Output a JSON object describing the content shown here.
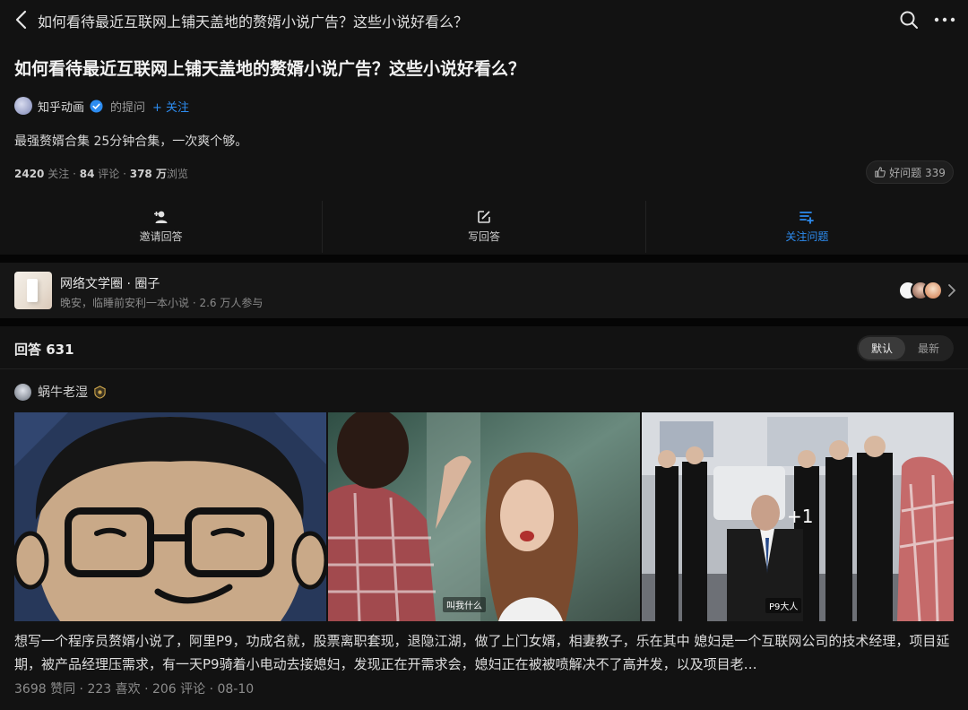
{
  "header": {
    "title": "如何看待最近互联网上铺天盖地的赘婿小说广告？这些小说好看么？"
  },
  "question": {
    "title": "如何看待最近互联网上铺天盖地的赘婿小说广告？这些小说好看么？",
    "asker_name": "知乎动画",
    "asker_role": "的提问",
    "follow_label": "+ 关注",
    "description": "最强赘婿合集 25分钟合集，一次爽个够。",
    "followers_count": "2420",
    "followers_label": "关注",
    "comments_count": "84",
    "comments_label": "评论",
    "views_count": "378 万",
    "views_label": "浏览",
    "good_question_label": "好问题 339"
  },
  "actions": {
    "invite": "邀请回答",
    "write": "写回答",
    "follow": "关注问题"
  },
  "circle": {
    "name": "网络文学圈 · 圈子",
    "subtitle": "晚安，临睡前安利一本小说 · 2.6 万人参与"
  },
  "answers": {
    "title": "回答 631",
    "sort_default": "默认",
    "sort_latest": "最新"
  },
  "answer": {
    "author": "蜗牛老湿",
    "image_plus": "+1",
    "subtitle_2": "叫我什么",
    "subtitle_3": "P9大人",
    "excerpt": "想写一个程序员赘婿小说了，阿里P9，功成名就，股票离职套现，退隐江湖，做了上门女婿，相妻教子，乐在其中 媳妇是一个互联网公司的技术经理，项目延期，被产品经理压需求，有一天P9骑着小电动去接媳妇，发现正在开需求会，媳妇正在被被喷解决不了高并发，以及项目老…",
    "upvotes": "3698 赞同",
    "likes": "223 喜欢",
    "comments": "206 评论",
    "date": "08-10"
  },
  "colors": {
    "accent": "#2d8cf0",
    "background": "#121212"
  }
}
